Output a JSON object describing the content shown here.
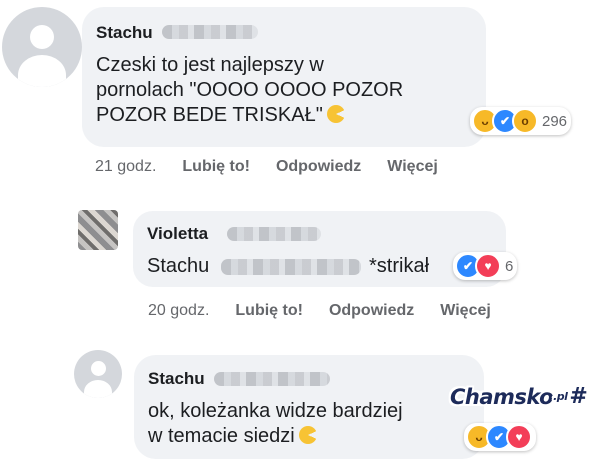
{
  "comments": [
    {
      "author": "Stachu",
      "text_lines": [
        "Czeski to jest najlepszy w",
        "pornolach \"OOOO OOOO POZOR",
        "POZOR BEDE TRISKAŁ\""
      ],
      "reactions": [
        "haha",
        "like",
        "wow"
      ],
      "reaction_count": "296",
      "time": "21 godz.",
      "actions": [
        "Lubię to!",
        "Odpowiedz",
        "Więcej"
      ]
    },
    {
      "author": "Violetta",
      "text_lines": [
        "Stachu",
        "*strikał"
      ],
      "reactions": [
        "like",
        "love"
      ],
      "reaction_count": "6",
      "time": "20 godz.",
      "actions": [
        "Lubię to!",
        "Odpowiedz",
        "Więcej"
      ]
    },
    {
      "author": "Stachu",
      "text_lines": [
        "ok, koleżanka widze bardziej",
        "w temacie siedzi"
      ],
      "reactions": [
        "haha",
        "like",
        "love"
      ]
    }
  ],
  "watermark": {
    "name": "Chamsko",
    "tld": ".pl"
  },
  "colors": {
    "like": "#2d88ff",
    "love": "#f33e58",
    "haha": "#f7b928",
    "bubble": "#f0f2f5",
    "meta": "#65676b"
  }
}
